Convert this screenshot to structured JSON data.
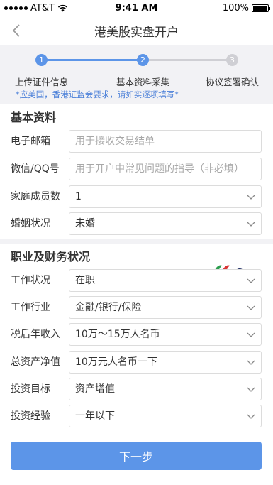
{
  "status_bar": {
    "carrier": "AT&T",
    "time": "9:41 AM",
    "battery": "100%",
    "battery_level": 1.0
  },
  "nav": {
    "title": "港美股实盘开户",
    "back_icon": "chevron-left-icon"
  },
  "progress": {
    "active_color": "#5c95e8",
    "inactive_color": "#cfcfd4",
    "steps": [
      {
        "number": "1",
        "label": "上传证件信息",
        "state": "done"
      },
      {
        "number": "2",
        "label": "基本资料采集",
        "state": "active"
      },
      {
        "number": "3",
        "label": "协议签署确认",
        "state": "pending"
      }
    ],
    "notice": "*应美国，香港证监会要求，请如实逐项填写*"
  },
  "basic_info": {
    "heading": "基本资料",
    "email": {
      "label": "电子邮箱",
      "value": "",
      "placeholder": "用于接收交易结单"
    },
    "wechat_qq": {
      "label": "微信/QQ号",
      "value": "",
      "placeholder": "用于开户中常见问题的指导（非必填）"
    },
    "family_members": {
      "label": "家庭成员数",
      "value": "1"
    },
    "marital_status": {
      "label": "婚姻状况",
      "value": "未婚"
    }
  },
  "career_finance": {
    "heading": "职业及财务状况",
    "employment_status": {
      "label": "工作状况",
      "value": "在职"
    },
    "industry": {
      "label": "工作行业",
      "value": "金融/银行/保险"
    },
    "annual_income": {
      "label": "税后年收入",
      "value": "10万～15万人名币"
    },
    "net_assets": {
      "label": "总资产净值",
      "value": "10万元人名币一下"
    },
    "investment_goal": {
      "label": "投资目标",
      "value": "资产增值"
    },
    "investment_experience": {
      "label": "投资经验",
      "value": "一年以下"
    }
  },
  "next_button": {
    "label": "下一步"
  },
  "colors": {
    "accent": "#5c95e8",
    "notice_text": "#4a7fd8",
    "band": "#f2f2f5"
  }
}
